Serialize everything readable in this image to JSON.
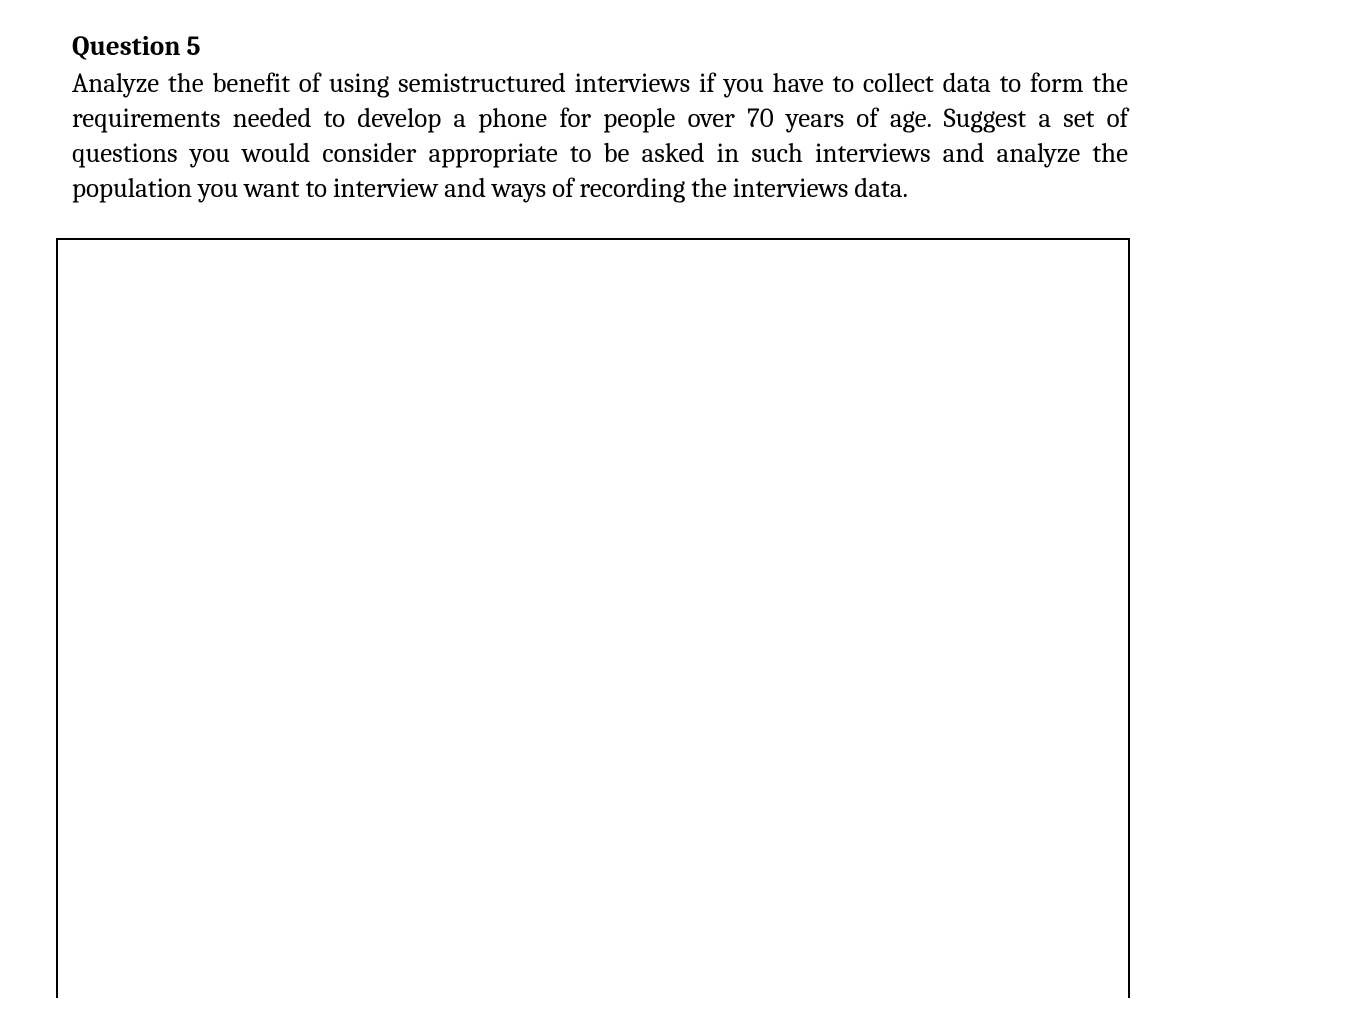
{
  "question": {
    "title": "Question 5",
    "body": "Analyze the benefit of using semistructured interviews if you have to collect data to form the requirements needed to develop a phone for people over 70 years of age. Suggest a set of questions you would consider appropriate to be asked in such interviews and analyze the population you want to interview and ways of recording the interviews data."
  }
}
